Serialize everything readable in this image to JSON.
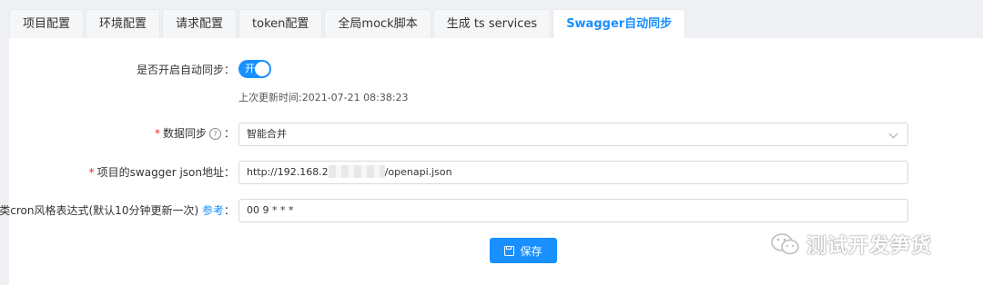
{
  "tabs": [
    "项目配置",
    "环境配置",
    "请求配置",
    "token配置",
    "全局mock脚本",
    "生成 ts services",
    "Swagger自动同步"
  ],
  "active_tab": "Swagger自动同步",
  "form": {
    "auto_sync_label": "是否开启自动同步：",
    "switch_text": "开",
    "last_update": "上次更新时间:2021-07-21 08:38:23",
    "data_sync_label": "数据同步",
    "data_sync_suffix": "：",
    "data_sync_value": "智能合并",
    "json_url_label": "项目的swagger json地址：",
    "json_url_prefix": "http://192.168.2",
    "json_url_suffix": "/openapi.json",
    "cron_label": "类cron风格表达式(默认10分钟更新一次)",
    "cron_ref": "参考",
    "cron_colon": "：",
    "cron_value": "00 9 * * *",
    "required_mark": "*",
    "help_mark": "?"
  },
  "save_label": "保存",
  "watermark": "测试开发笋货",
  "colors": {
    "accent": "#1890ff",
    "required": "#f5222d"
  }
}
